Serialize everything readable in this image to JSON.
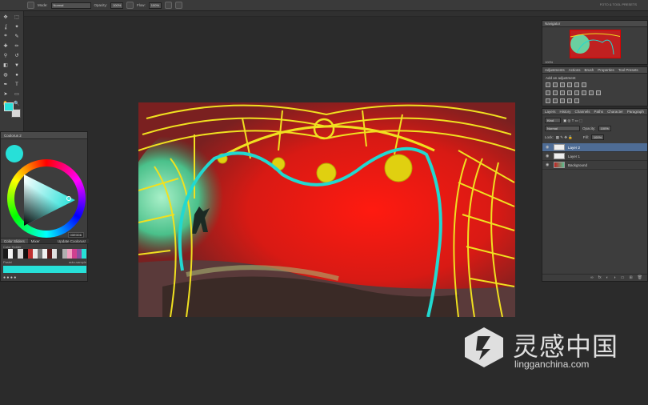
{
  "options_bar": {
    "mode_label": "Mode:",
    "mode_value": "Normal",
    "opacity_label": "Opacity:",
    "opacity_value": "100%",
    "flow_label": "Flow:",
    "flow_value": "100%",
    "workspace": "FOTO & TOOL PRESETS"
  },
  "tools": {
    "icons": [
      "move-icon",
      "marquee-icon",
      "lasso-icon",
      "quick-select-icon",
      "crop-icon",
      "eyedropper-icon",
      "healing-icon",
      "brush-icon",
      "stamp-icon",
      "history-brush-icon",
      "eraser-icon",
      "fill-icon",
      "blur-icon",
      "dodge-icon",
      "pen-icon",
      "type-icon",
      "path-select-icon",
      "shape-icon",
      "hand-icon",
      "zoom-icon"
    ],
    "glyphs": [
      "✥",
      "⬚",
      "ʆ",
      "✦",
      "⌗",
      "✎",
      "✚",
      "✏",
      "⚲",
      "↺",
      "◧",
      "▼",
      "◍",
      "●",
      "✒",
      "T",
      "➤",
      "▭",
      "✋",
      "🔍"
    ],
    "foreground_color": "#27e0d8",
    "background_color": "#d8d8d8"
  },
  "coolorus": {
    "title": "Coolorus 2",
    "hex_value": "00E0D6",
    "tabs": [
      "Color Sliders",
      "Mixer",
      "Update Coolorus!"
    ],
    "active_tab": 0,
    "palette_label": "Color Holder",
    "palette_right": "auto-sample",
    "swatch_name": "Pastel",
    "palette": [
      "#1a1a1a",
      "#f4f4f4",
      "#2a2a2a",
      "#d8d8d8",
      "#111",
      "#c03030",
      "#e8e8e8",
      "#777",
      "#f0f0f0",
      "#5a1a1a",
      "#e0e0e0",
      "#3a3a3a",
      "#b0b0b0",
      "#f2a0c0",
      "#d04090",
      "#8a4fa0",
      "#27e0d8"
    ]
  },
  "navigator": {
    "title": "Navigator",
    "zoom": "100%"
  },
  "adjustments": {
    "tabs": [
      "Adjustments",
      "Actions",
      "Brush",
      "Properties",
      "Tool Presets"
    ],
    "subtitle": "Add an adjustment"
  },
  "layers": {
    "tabs": [
      "Layers",
      "History",
      "Channels",
      "Paths",
      "Character",
      "Paragraph"
    ],
    "kind_label": "Kind",
    "blend_mode": "Normal",
    "opacity_label": "Opacity:",
    "opacity_value": "100%",
    "lock_label": "Lock:",
    "fill_label": "Fill:",
    "fill_value": "100%",
    "items": [
      {
        "name": "Layer 2",
        "selected": true
      },
      {
        "name": "Layer 1",
        "selected": false
      },
      {
        "name": "Background",
        "selected": false
      }
    ],
    "footer_icons": [
      "link-icon",
      "fx-icon",
      "mask-icon",
      "adjustment-layer-icon",
      "group-icon",
      "new-layer-icon",
      "trash-icon"
    ],
    "footer_glyphs": [
      "∞",
      "fx",
      "◐",
      "◑",
      "▭",
      "⊞",
      "🗑"
    ]
  },
  "watermark": {
    "chinese": "灵感中国",
    "url": "lingganchina.com"
  }
}
